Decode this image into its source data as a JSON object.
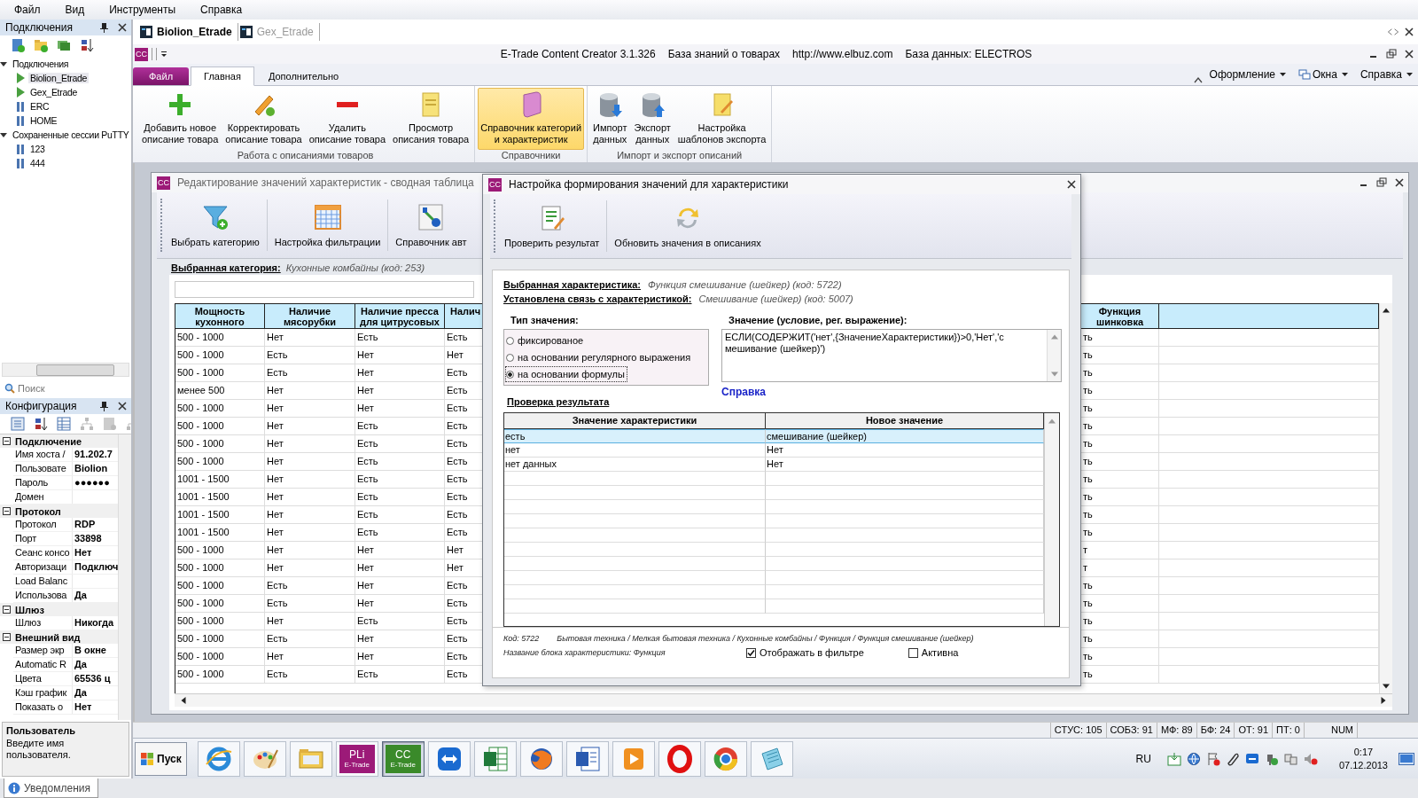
{
  "menu": [
    "Файл",
    "Вид",
    "Инструменты",
    "Справка"
  ],
  "connections_panel": {
    "title": "Подключения",
    "tree": [
      {
        "label": "Подключения",
        "expanded": true,
        "selected": false,
        "children": [
          {
            "label": "Biolion_Etrade",
            "connected": true,
            "selected": true
          },
          {
            "label": "Gex_Etrade",
            "connected": true,
            "selected": false
          },
          {
            "label": "ERC",
            "connected": false,
            "selected": false
          },
          {
            "label": "HOME",
            "connected": false,
            "selected": false
          }
        ]
      },
      {
        "label": "Сохраненные сессии PuTTY",
        "expanded": true,
        "selected": false,
        "children": [
          {
            "label": "123",
            "connected": false,
            "selected": false
          },
          {
            "label": "444",
            "connected": false,
            "selected": false
          }
        ]
      }
    ],
    "search": {
      "placeholder": "Поиск"
    }
  },
  "config_panel": {
    "title": "Конфигурация",
    "categories": [
      {
        "label": "Подключение",
        "expanded": true,
        "children": [
          {
            "name": "Имя хоста /",
            "value": "91.202.7"
          },
          {
            "name": "Пользовате",
            "value": "Biolion"
          },
          {
            "name": "Пароль",
            "value": "●●●●●●"
          },
          {
            "name": "Домен"
          }
        ]
      },
      {
        "label": "Протокол",
        "expanded": true,
        "children": [
          {
            "name": "Протокол",
            "value": "RDP"
          },
          {
            "name": "Порт",
            "value": "33898"
          },
          {
            "name": "Сеанс консо",
            "value": "Нет"
          },
          {
            "name": "Авторизаци",
            "value": "Подключ"
          },
          {
            "name": "Load Balanc"
          },
          {
            "name": "Использова",
            "value": "Да"
          }
        ]
      },
      {
        "label": "Шлюз",
        "expanded": true,
        "children": [
          {
            "name": "Шлюз",
            "value": "Никогда"
          }
        ]
      },
      {
        "label": "Внешний вид",
        "expanded": true,
        "children": [
          {
            "name": "Размер экр",
            "value": "В окне"
          },
          {
            "name": "Automatic R",
            "value": "Да"
          },
          {
            "name": "Цвета",
            "value": "65536 ц"
          },
          {
            "name": "Кэш график",
            "value": "Да"
          },
          {
            "name": "Показать о",
            "value": "Нет"
          }
        ]
      }
    ],
    "description": {
      "title": "Пользователь",
      "text": "Введите имя пользователя."
    }
  },
  "notifications_tab": "Уведомления",
  "document_tabs": [
    {
      "label": "Biolion_Etrade",
      "selected": true
    },
    {
      "label": "Gex_Etrade",
      "selected": false
    }
  ],
  "app": {
    "logo": "CC",
    "title_items": [
      "E-Trade Content Creator 3.1.326",
      "База знаний о товарах",
      "http://www.elbuz.com",
      "База данных: ELECTROS"
    ],
    "ribbon_tabs": [
      {
        "label": "Файл",
        "kind": "file",
        "selected": false
      },
      {
        "label": "Главная",
        "kind": "tab",
        "selected": true
      },
      {
        "label": "Дополнительно",
        "kind": "tab",
        "selected": false
      }
    ],
    "ribbon_menus": [
      "Оформление",
      "Окна",
      "Справка"
    ],
    "ribbon_groups": [
      {
        "label": "Работа с описаниями товаров",
        "buttons": [
          {
            "label": "Добавить новое\nописание товара",
            "selected": false
          },
          {
            "label": "Корректировать\nописание товара",
            "selected": false
          },
          {
            "label": "Удалить\nописание товара",
            "selected": false
          },
          {
            "label": "Просмотр\nописания товара",
            "selected": false
          }
        ]
      },
      {
        "label": "Справочники",
        "buttons": [
          {
            "label": "Справочник категорий\nи характеристик",
            "selected": true
          }
        ]
      },
      {
        "label": "Импорт и экспорт описаний",
        "buttons": [
          {
            "label": "Импорт\nданных",
            "selected": false
          },
          {
            "label": "Экспорт\nданных",
            "selected": false
          },
          {
            "label": "Настройка\nшаблонов экспорта",
            "selected": false
          }
        ]
      }
    ]
  },
  "child_window": {
    "logo": "CC",
    "title": "Редактирование значений характеристик - сводная таблица",
    "toolbar": [
      "Выбрать категорию",
      "Настройка фильтрации",
      "Справочник авт"
    ],
    "category_label": "Выбранная категория:",
    "category_value": "Кухонные комбайны (код: 253)",
    "table": {
      "columns": [
        "Мощность\nкухонного",
        "Наличие\nмясорубки",
        "Наличие пресса\nдля цитрусовых",
        "Налич",
        "Функция\nшинковка"
      ],
      "rows": [
        [
          "500 - 1000",
          "Нет",
          "Есть",
          "Есть",
          "ть"
        ],
        [
          "500 - 1000",
          "Есть",
          "Нет",
          "Нет",
          "ть"
        ],
        [
          "500 - 1000",
          "Есть",
          "Нет",
          "Есть",
          "ть"
        ],
        [
          "менее 500",
          "Нет",
          "Нет",
          "Есть",
          "ть"
        ],
        [
          "500 - 1000",
          "Нет",
          "Нет",
          "Есть",
          "ть"
        ],
        [
          "500 - 1000",
          "Нет",
          "Есть",
          "Есть",
          "ть"
        ],
        [
          "500 - 1000",
          "Нет",
          "Есть",
          "Есть",
          "ть"
        ],
        [
          "500 - 1000",
          "Нет",
          "Есть",
          "Есть",
          "ть"
        ],
        [
          "1001 - 1500",
          "Нет",
          "Есть",
          "Есть",
          "ть"
        ],
        [
          "1001 - 1500",
          "Нет",
          "Есть",
          "Есть",
          "ть"
        ],
        [
          "1001 - 1500",
          "Нет",
          "Есть",
          "Есть",
          "ть"
        ],
        [
          "1001 - 1500",
          "Нет",
          "Есть",
          "Есть",
          "ть"
        ],
        [
          "500 - 1000",
          "Нет",
          "Нет",
          "Нет",
          "т"
        ],
        [
          "500 - 1000",
          "Нет",
          "Нет",
          "Нет",
          "т"
        ],
        [
          "500 - 1000",
          "Есть",
          "Нет",
          "Есть",
          "ть"
        ],
        [
          "500 - 1000",
          "Есть",
          "Нет",
          "Есть",
          "ть"
        ],
        [
          "500 - 1000",
          "Нет",
          "Есть",
          "Есть",
          "ть"
        ],
        [
          "500 - 1000",
          "Есть",
          "Нет",
          "Есть",
          "ть"
        ],
        [
          "500 - 1000",
          "Нет",
          "Нет",
          "Есть",
          "ть"
        ],
        [
          "500 - 1000",
          "Есть",
          "Есть",
          "Есть",
          "ть"
        ]
      ]
    }
  },
  "dialog": {
    "logo": "CC",
    "title": "Настройка формирования значений для характеристики",
    "toolbar": [
      "Проверить результат",
      "Обновить значения в описаниях"
    ],
    "characteristic_label": "Выбранная характеристика:",
    "characteristic_value": "Функция смешивание (шейкер) (код: 5722)",
    "link_label": "Установлена связь с характеристикой:",
    "link_value": "Смешивание (шейкер) (код: 5007)",
    "value_type_label": "Тип значения:",
    "value_types": [
      {
        "label": "фиксированое",
        "selected": false
      },
      {
        "label": "на основании регулярного выражения",
        "selected": false
      },
      {
        "label": "на основании формулы",
        "selected": true
      }
    ],
    "value_label": "Значение (условие, рег. выражение):",
    "value": "ЕСЛИ(СОДЕРЖИТ('нет',{ЗначениеХарактеристики})>0,'Нет','смешивание (шейкер)')",
    "help_link": "Справка",
    "check_label": "Проверка результата",
    "result_grid": {
      "columns": [
        "Значение характеристики",
        "Новое значение"
      ],
      "rows": [
        {
          "cells": [
            "есть",
            "смешивание (шейкер)"
          ],
          "selected": true
        },
        {
          "cells": [
            "нет",
            "Нет"
          ],
          "selected": false
        },
        {
          "cells": [
            "нет данных",
            "Нет"
          ],
          "selected": false
        }
      ]
    },
    "code": "Код: 5722",
    "path": "Бытовая техника / Мелкая бытовая техника / Кухонные комбайны / Функция / Функция смешивание (шейкер)",
    "block_name": "Название блока характеристики: Функция",
    "checkboxes": [
      {
        "label": "Отображать в фильтре",
        "checked": true
      },
      {
        "label": "Активна",
        "checked": false
      }
    ]
  },
  "status_bar": [
    "СТУС: 105",
    "СОБЗ: 91",
    "МФ: 89",
    "БФ: 24",
    "ОТ: 91",
    "ПТ: 0",
    "NUM"
  ],
  "taskbar": {
    "start": "Пуск",
    "apps": [
      {
        "active": false
      },
      {
        "active": false
      },
      {
        "active": false
      },
      {
        "label": "PLi",
        "sublabel": "E-Trade",
        "active": false
      },
      {
        "label": "CC",
        "sublabel": "E-Trade",
        "active": true
      },
      {
        "active": false
      },
      {
        "active": false
      },
      {
        "active": false
      },
      {
        "active": false
      },
      {
        "active": false
      },
      {
        "active": false
      },
      {
        "active": false
      },
      {
        "active": false
      }
    ],
    "language": "RU",
    "time": "0:17",
    "date": "07.12.2013"
  }
}
